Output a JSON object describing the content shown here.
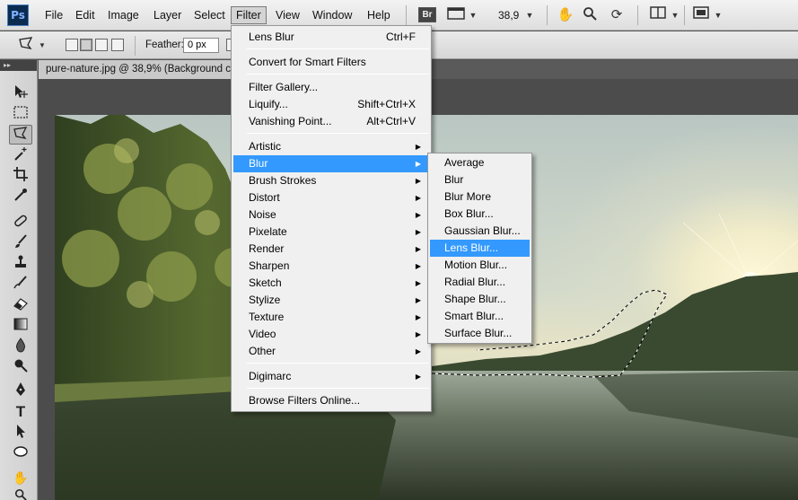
{
  "app": {
    "logo": "Ps",
    "menus": [
      "File",
      "Edit",
      "Image",
      "Layer",
      "Select",
      "Filter",
      "View",
      "Window",
      "Help"
    ],
    "active_menu": "Filter",
    "bridge_badge": "Br",
    "zoom_value": "38,9",
    "icons": {
      "screen_mode": "screen-mode-icon",
      "hand": "hand-icon",
      "zoom": "zoom-icon",
      "rotate": "rotate-view-icon",
      "arrange": "arrange-documents-icon",
      "screen": "screen-mode-icon"
    }
  },
  "options_bar": {
    "tool_icon": "polygonal-lasso-icon",
    "feather_label": "Feather:",
    "feather_value": "0 px"
  },
  "toolbar": {
    "grip": "▸▸",
    "tools": [
      "move-tool",
      "marquee-tool",
      "polygonal-lasso-tool",
      "magic-wand-tool",
      "crop-tool",
      "eyedropper-tool",
      "healing-brush-tool",
      "brush-tool",
      "clone-stamp-tool",
      "history-brush-tool",
      "eraser-tool",
      "gradient-tool",
      "blur-tool",
      "dodge-tool",
      "pen-tool",
      "type-tool",
      "path-selection-tool",
      "ellipse-tool",
      "hand-tool",
      "zoom-tool"
    ],
    "selected": "polygonal-lasso-tool"
  },
  "document": {
    "tab_title": "pure-nature.jpg @ 38,9% (Background c"
  },
  "filter_menu": {
    "items": [
      {
        "label": "Lens Blur",
        "shortcut": "Ctrl+F"
      },
      {
        "label": "Convert for Smart Filters"
      },
      {
        "label": "Filter Gallery..."
      },
      {
        "label": "Liquify...",
        "shortcut": "Shift+Ctrl+X"
      },
      {
        "label": "Vanishing Point...",
        "shortcut": "Alt+Ctrl+V"
      },
      {
        "label": "Artistic",
        "submenu": true
      },
      {
        "label": "Blur",
        "submenu": true,
        "highlighted": true
      },
      {
        "label": "Brush Strokes",
        "submenu": true
      },
      {
        "label": "Distort",
        "submenu": true
      },
      {
        "label": "Noise",
        "submenu": true
      },
      {
        "label": "Pixelate",
        "submenu": true
      },
      {
        "label": "Render",
        "submenu": true
      },
      {
        "label": "Sharpen",
        "submenu": true
      },
      {
        "label": "Sketch",
        "submenu": true
      },
      {
        "label": "Stylize",
        "submenu": true
      },
      {
        "label": "Texture",
        "submenu": true
      },
      {
        "label": "Video",
        "submenu": true
      },
      {
        "label": "Other",
        "submenu": true
      },
      {
        "label": "Digimarc",
        "submenu": true
      },
      {
        "label": "Browse Filters Online..."
      }
    ]
  },
  "blur_submenu": {
    "items": [
      "Average",
      "Blur",
      "Blur More",
      "Box Blur...",
      "Gaussian Blur...",
      "Lens Blur...",
      "Motion Blur...",
      "Radial Blur...",
      "Shape Blur...",
      "Smart Blur...",
      "Surface Blur..."
    ],
    "highlighted": "Lens Blur..."
  },
  "colors": {
    "highlight": "#3399ff",
    "menu_bg": "#f0f0f0",
    "workspace": "#4c4c4c"
  }
}
